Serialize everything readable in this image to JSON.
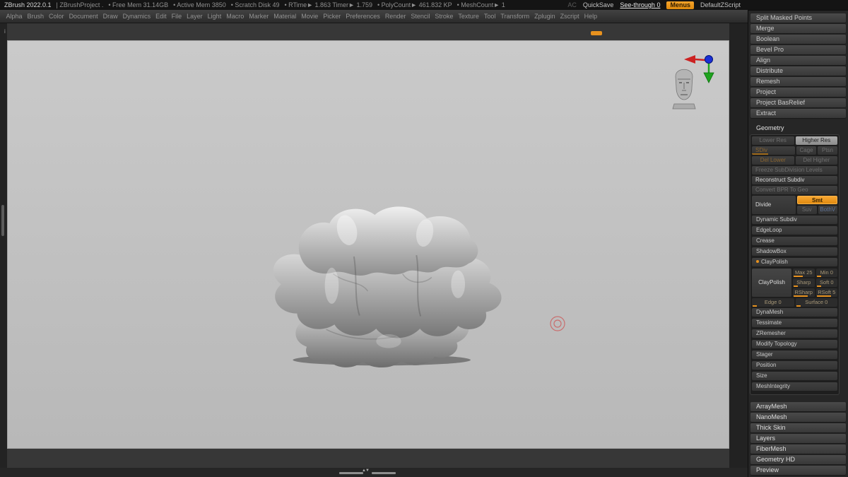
{
  "accent": "#e8921e",
  "title_bar": {
    "segments": [
      "ZBrush 2022.0.1",
      "| ZBrushProject .",
      "• Free Mem 31.14GB",
      "• Active Mem 3850",
      "• Scratch Disk 49",
      "• RTime► 1.863 Timer► 1.759",
      "• PolyCount► 461.832 KP",
      "• MeshCount► 1"
    ],
    "ac": "AC",
    "quicksave": "QuickSave",
    "see_through": "See-through 0",
    "menus": "Menus",
    "zscript": "DefaultZScript"
  },
  "menu_bar": {
    "items": [
      "Alpha",
      "Brush",
      "Color",
      "Document",
      "Draw",
      "Dynamics",
      "Edit",
      "File",
      "Layer",
      "Light",
      "Macro",
      "Marker",
      "Material",
      "Movie",
      "Picker",
      "Preferences",
      "Render",
      "Stencil",
      "Stroke",
      "Texture",
      "Tool",
      "Transform",
      "Zplugin",
      "Zscript",
      "Help"
    ]
  },
  "canvas": {
    "info_marker": "i",
    "scroll_arrows": "▲▼"
  },
  "right_panel": {
    "top_items": [
      "Split Masked Points",
      "Merge",
      "Boolean",
      "Bevel Pro",
      "Align",
      "Distribute",
      "Remesh",
      "Project",
      "Project BasRelief",
      "Extract"
    ],
    "geometry": {
      "header": "Geometry",
      "lower_res": "Lower Res",
      "higher_res": "Higher Res",
      "sdiv": "SDiv",
      "cage": "Cage",
      "ptsn": "Ptsn",
      "del_lower": "Del Lower",
      "del_higher": "Del Higher",
      "freeze": "Freeze SubDivision Levels",
      "reconstruct": "Reconstruct Subdiv",
      "convert_bpr": "Convert BPR To Geo",
      "divide": "Divide",
      "smt": "Smt",
      "suv": "Suv",
      "bothv": "BothV",
      "sections_upper": [
        "Dynamic Subdiv",
        "EdgeLoop",
        "Crease",
        "ShadowBox"
      ],
      "claypolish_header": "ClayPolish",
      "claypolish_button": "ClayPolish",
      "cp_max": "Max 25",
      "cp_min": "Min 0",
      "cp_sharp": "Sharp",
      "cp_soft": "Soft 0",
      "cp_rsharp": "RSharp",
      "cp_rsoft": "RSoft 5",
      "cp_edge": "Edge 0",
      "cp_surface": "Surface 0",
      "sections_lower": [
        "DynaMesh",
        "Tessimate",
        "ZRemesher",
        "Modify Topology",
        "Stager",
        "Position",
        "Size",
        "MeshIntegrity"
      ]
    },
    "bottom_items": [
      "ArrayMesh",
      "NanoMesh",
      "Thick Skin",
      "Layers",
      "FiberMesh",
      "Geometry HD",
      "Preview"
    ]
  }
}
